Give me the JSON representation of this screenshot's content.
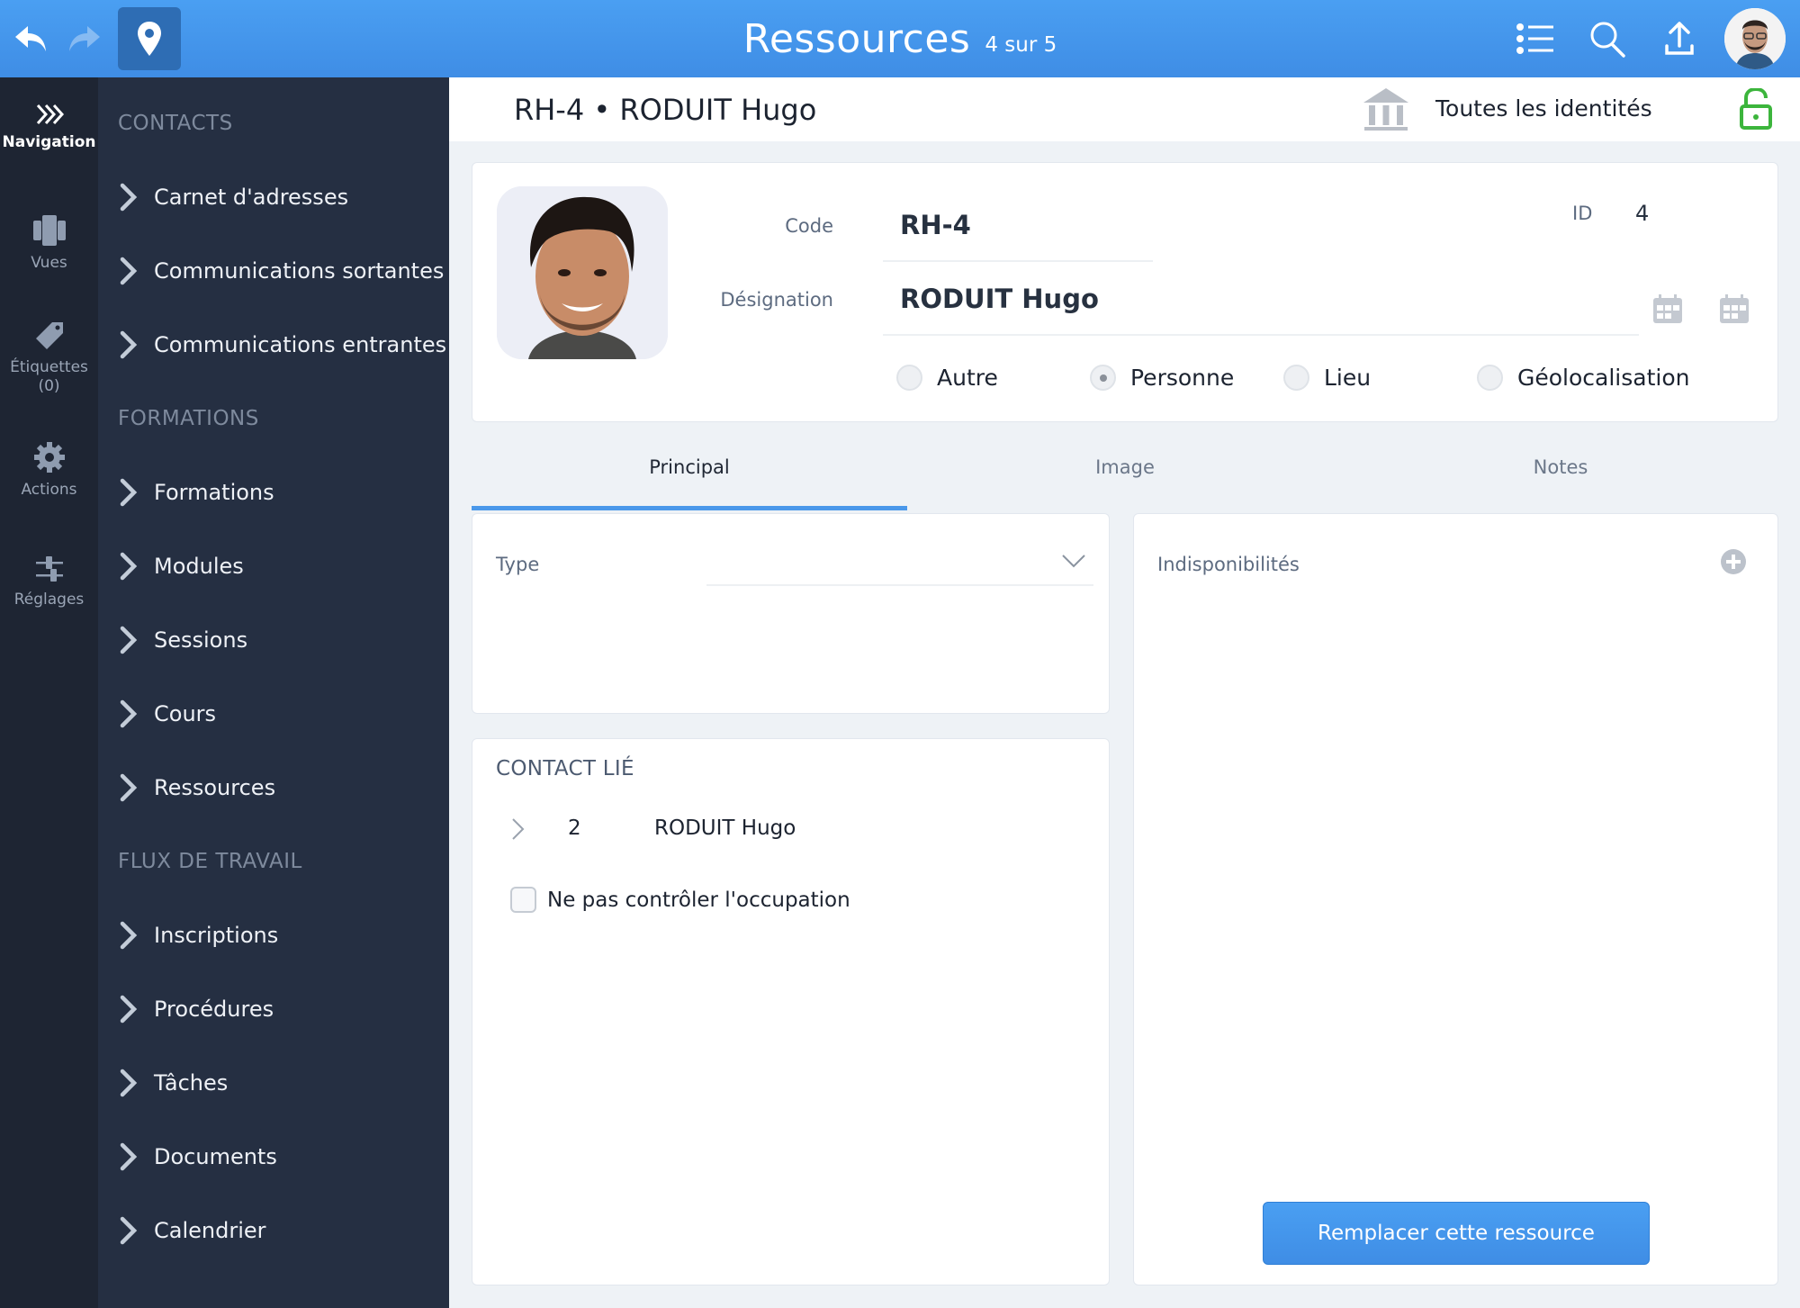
{
  "header": {
    "title": "Ressources",
    "subtitle": "4 sur 5",
    "icons": [
      "undo-icon",
      "redo-icon",
      "map-pin-icon",
      "list-icon",
      "search-icon",
      "upload-icon",
      "user-avatar"
    ]
  },
  "rail": {
    "items": [
      {
        "label": "Navigation",
        "icon": "double-chevron-right-icon",
        "active": true
      },
      {
        "label": "Vues",
        "icon": "views-icon"
      },
      {
        "label": "Étiquettes\n(0)",
        "label_line1": "Étiquettes",
        "label_line2": "(0)",
        "icon": "tag-icon"
      },
      {
        "label": "Actions",
        "icon": "gear-icon"
      },
      {
        "label": "Réglages",
        "icon": "sliders-icon"
      }
    ]
  },
  "nav": {
    "sections": [
      {
        "title": "CONTACTS",
        "items": [
          "Carnet d'adresses",
          "Communications sortantes",
          "Communications entrantes"
        ]
      },
      {
        "title": "FORMATIONS",
        "items": [
          "Formations",
          "Modules",
          "Sessions",
          "Cours",
          "Ressources"
        ]
      },
      {
        "title": "FLUX DE TRAVAIL",
        "items": [
          "Inscriptions",
          "Procédures",
          "Tâches",
          "Documents",
          "Calendrier"
        ]
      }
    ]
  },
  "record": {
    "title": "RH-4 • RODUIT Hugo",
    "identities_label": "Toutes les identités",
    "lock_state": "unlocked",
    "lock_color": "#3cb53c"
  },
  "form": {
    "code_label": "Code",
    "code_value": "RH-4",
    "designation_label": "Désignation",
    "designation_value": "RODUIT Hugo",
    "id_label": "ID",
    "id_value": "4",
    "radios": [
      {
        "label": "Autre",
        "checked": false
      },
      {
        "label": "Personne",
        "checked": true
      },
      {
        "label": "Lieu",
        "checked": false
      },
      {
        "label": "Géolocalisation",
        "checked": false
      }
    ]
  },
  "tabs": [
    {
      "label": "Principal",
      "active": true
    },
    {
      "label": "Image",
      "active": false
    },
    {
      "label": "Notes",
      "active": false
    }
  ],
  "principal": {
    "type_label": "Type",
    "type_value": "",
    "contact_title": "CONTACT LIÉ",
    "contact": {
      "id": "2",
      "name": "RODUIT Hugo"
    },
    "checkbox_label": "Ne pas contrôler l'occupation",
    "checkbox_checked": false,
    "indispo_title": "Indisponibilités",
    "replace_button": "Remplacer cette ressource"
  },
  "colors": {
    "accent": "#4a9ff2",
    "rail_bg": "#1e2533",
    "nav_bg": "#252f42",
    "page_bg": "#eef2f6"
  }
}
